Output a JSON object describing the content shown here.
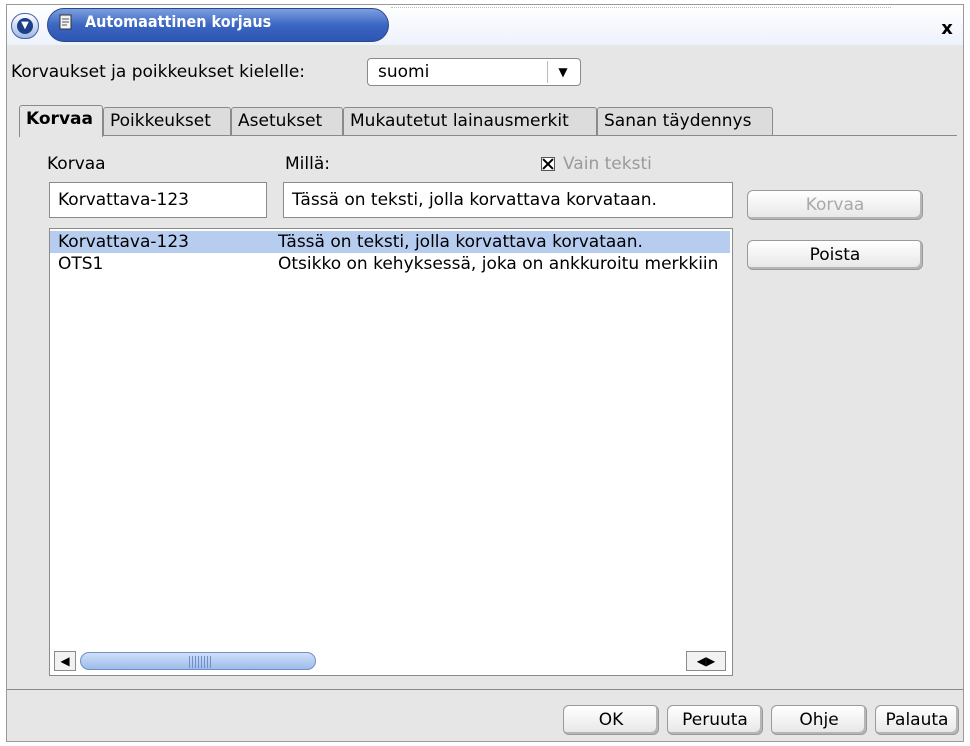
{
  "window": {
    "title": "Automaattinen korjaus",
    "close_label": "x"
  },
  "language": {
    "label": "Korvaukset ja poikkeukset kielelle:",
    "selected": "suomi"
  },
  "tabs": [
    {
      "label": "Korvaa",
      "active": true
    },
    {
      "label": "Poikkeukset",
      "active": false
    },
    {
      "label": "Asetukset",
      "active": false
    },
    {
      "label": "Mukautetut lainausmerkit",
      "active": false
    },
    {
      "label": "Sanan täydennys",
      "active": false
    }
  ],
  "replace": {
    "replace_label": "Korvaa",
    "with_label": "Millä:",
    "text_only_label": "Vain teksti",
    "text_only_checked": true,
    "replace_value": "Korvattava-123",
    "with_value": "Tässä on teksti, jolla korvattava korvataan.",
    "replace_button": "Korvaa",
    "delete_button": "Poista"
  },
  "list": {
    "rows": [
      {
        "replace": "Korvattava-123",
        "with": "Tässä on teksti, jolla korvattava korvataan.",
        "selected": true
      },
      {
        "replace": "OTS1",
        "with": "Otsikko on kehyksessä, joka on ankkuroitu merkkiin",
        "selected": false
      }
    ]
  },
  "buttons": {
    "ok": "OK",
    "cancel": "Peruuta",
    "help": "Ohje",
    "reset": "Palauta"
  },
  "colors": {
    "title_accent": "#3b66c2",
    "selection": "#b7cdf0",
    "dialog_bg": "#e6e6e6"
  }
}
